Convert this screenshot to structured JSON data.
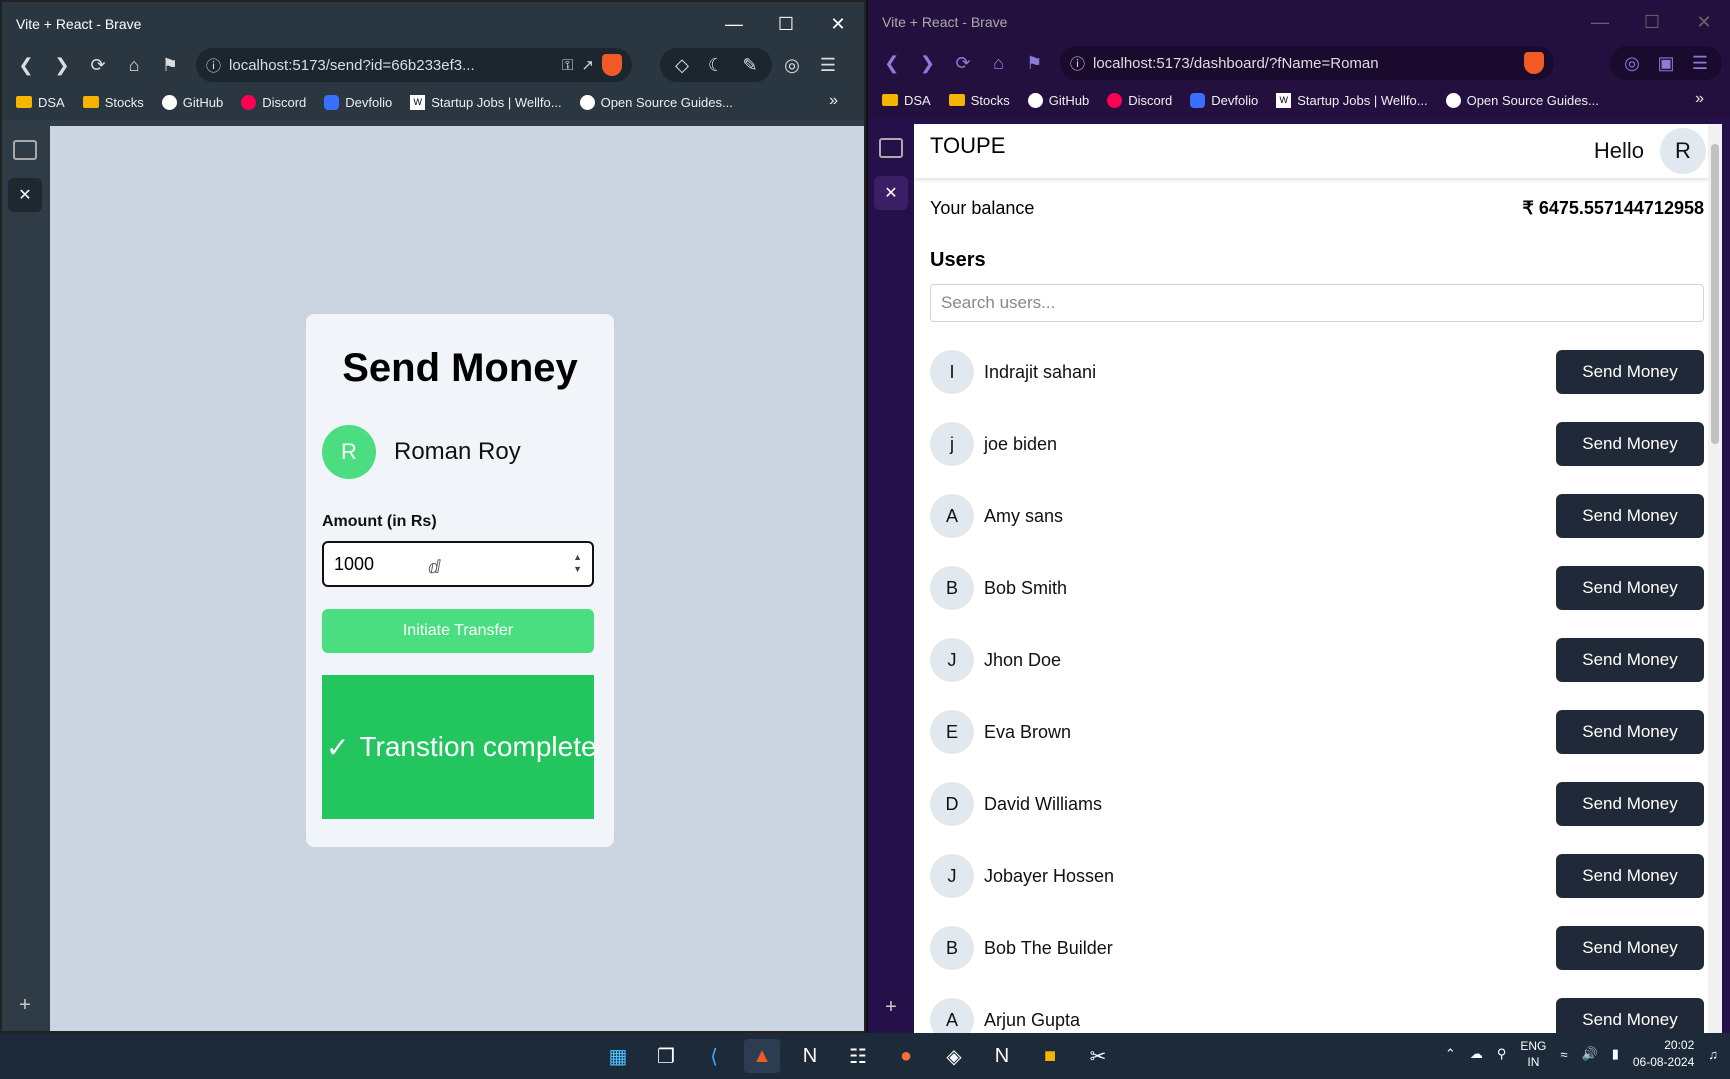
{
  "left_window": {
    "title": "Vite + React - Brave",
    "url": "localhost:5173/send?id=66b233ef3...",
    "bookmarks": [
      "DSA",
      "Stocks",
      "GitHub",
      "Discord",
      "Devfolio",
      "Startup Jobs | Wellfo...",
      "Open Source Guides..."
    ],
    "page": {
      "heading": "Send Money",
      "recipient_initial": "R",
      "recipient_name": "Roman Roy",
      "amount_label": "Amount (in Rs)",
      "amount_value": "1000",
      "transfer_button": "Initiate Transfer",
      "success_message": "Transtion complete"
    }
  },
  "right_window": {
    "title": "Vite + React - Brave",
    "url": "localhost:5173/dashboard/?fName=Roman",
    "bookmarks": [
      "DSA",
      "Stocks",
      "GitHub",
      "Discord",
      "Devfolio",
      "Startup Jobs | Wellfo...",
      "Open Source Guides..."
    ],
    "page": {
      "brand": "TOUPE",
      "greeting": "Hello",
      "user_initial": "R",
      "balance_label": "Your balance",
      "balance_value": "₹ 6475.557144712958",
      "users_title": "Users",
      "search_placeholder": "Search users...",
      "send_label": "Send Money",
      "users": [
        {
          "initial": "I",
          "name": "Indrajit sahani"
        },
        {
          "initial": "j",
          "name": "joe biden"
        },
        {
          "initial": "A",
          "name": "Amy sans"
        },
        {
          "initial": "B",
          "name": "Bob Smith"
        },
        {
          "initial": "J",
          "name": "Jhon Doe"
        },
        {
          "initial": "E",
          "name": "Eva Brown"
        },
        {
          "initial": "D",
          "name": "David Williams"
        },
        {
          "initial": "J",
          "name": "Jobayer Hossen"
        },
        {
          "initial": "B",
          "name": "Bob The Builder"
        },
        {
          "initial": "A",
          "name": "Arjun Gupta"
        }
      ]
    }
  },
  "taskbar": {
    "lang_top": "ENG",
    "lang_bottom": "IN",
    "time": "20:02",
    "date": "06-08-2024"
  }
}
